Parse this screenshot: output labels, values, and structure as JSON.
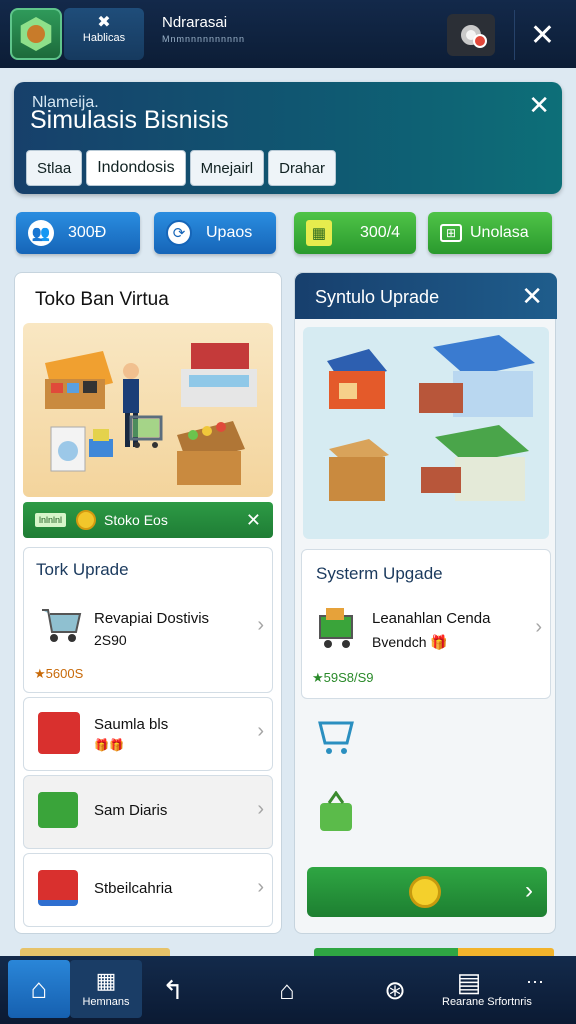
{
  "topbar": {
    "brand_glyph": "✖",
    "brand_label": "Hablicas",
    "app_title": "Ndrarasai",
    "app_subtitle": "Mnmnnnnnnnnnn",
    "close_glyph": "✕"
  },
  "header": {
    "small_title": "Nlameija.",
    "title": "Simulasis Bisnisis",
    "close_glyph": "✕",
    "tabs": [
      {
        "label": "Stlaa"
      },
      {
        "label": "Indondosis",
        "active": true
      },
      {
        "label": "Mnejairl"
      },
      {
        "label": "Drahar"
      }
    ]
  },
  "stats": [
    {
      "label": "300Ð",
      "color": "blue",
      "icon": "users-icon"
    },
    {
      "label": "Upaos",
      "color": "blue",
      "icon": "upgrade-icon"
    },
    {
      "label": "300/4",
      "color": "green",
      "icon": "gift-icon"
    },
    {
      "label": "Unolasa",
      "color": "green",
      "icon": "grid-icon"
    }
  ],
  "left_panel": {
    "title": "Toko Ban Virtua",
    "shop_bar": {
      "tag": "lnlnlnl",
      "label": "Stoko Eos",
      "close_glyph": "✕"
    },
    "upgrade_card": {
      "title": "Tork Uprade",
      "item_name": "Revapiai Dostivis",
      "item_sub": "2S90",
      "price": "★5600S"
    },
    "items": [
      {
        "label": "Saumla bls",
        "sub": "🎁🎁"
      },
      {
        "label": "Sam Diaris"
      },
      {
        "label": "Stbeilcahria"
      }
    ]
  },
  "right_panel": {
    "title": "Syntulo Uprade",
    "close_glyph": "✕",
    "upgrade_card": {
      "title": "Systerm Upgade",
      "item_name": "Leanahlan Cenda",
      "item_sub": "Bvendch 🎁",
      "price": "★59S8/S9"
    },
    "go_arrow": "›"
  },
  "bottom_nav": {
    "menu_label": "Hemnans",
    "right_label": "Rearane Srfortnris"
  },
  "colors": {
    "topbar": "#13294a",
    "accent_blue": "#1f78d1",
    "accent_green": "#2a9a2e",
    "header": "#0f5a72"
  }
}
